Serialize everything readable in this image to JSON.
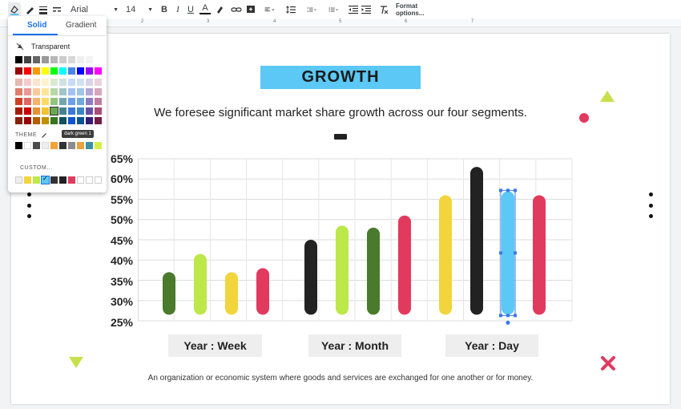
{
  "toolbar": {
    "font_name": "Arial",
    "font_size": "14",
    "bold": "B",
    "italic": "I",
    "underline": "U",
    "text_color": "A",
    "format_options": "Format options..."
  },
  "ruler_marks": [
    "2",
    "3",
    "4",
    "5",
    "6",
    "7"
  ],
  "slide": {
    "title": "GROWTH",
    "subtitle": "We foresee significant market share growth across our four segments.",
    "footer": "An organization or economic system where goods and services are exchanged for one another or for money."
  },
  "colors": {
    "accent": "#5bc8f5",
    "dark_green": "#4a7a2c",
    "lime": "#bde84a",
    "yellow": "#f2d53c",
    "crimson": "#e23a5e",
    "black": "#222222",
    "light_blue": "#5bc8f5",
    "triangle_green": "#c6e14a",
    "x_red": "#e23a5e",
    "circle_red": "#e23a5e"
  },
  "picker": {
    "tab_solid": "Solid",
    "tab_gradient": "Gradient",
    "transparent_label": "Transparent",
    "theme_label": "THEME",
    "custom_label": "CUSTOM...",
    "tooltip": "dark green 1"
  },
  "chart_data": {
    "type": "bar",
    "style": "rounded vertical capsules",
    "ylim": [
      25,
      65
    ],
    "yticks": [
      "65%",
      "60%",
      "55%",
      "50%",
      "45%",
      "40%",
      "35%",
      "30%",
      "25%"
    ],
    "groups": [
      {
        "label": "Year : Week",
        "bars": [
          {
            "color": "dark_green",
            "value": 37
          },
          {
            "color": "lime",
            "value": 41.5
          },
          {
            "color": "yellow",
            "value": 37
          },
          {
            "color": "crimson",
            "value": 38
          }
        ]
      },
      {
        "label": "Year : Month",
        "bars": [
          {
            "color": "black",
            "value": 45
          },
          {
            "color": "lime",
            "value": 48.5
          },
          {
            "color": "dark_green",
            "value": 48
          },
          {
            "color": "crimson",
            "value": 51
          }
        ]
      },
      {
        "label": "Year : Day",
        "bars": [
          {
            "color": "yellow",
            "value": 56
          },
          {
            "color": "black",
            "value": 63
          },
          {
            "color": "light_blue",
            "value": 57,
            "selected": true
          },
          {
            "color": "crimson",
            "value": 56
          }
        ]
      }
    ],
    "grid": true
  }
}
